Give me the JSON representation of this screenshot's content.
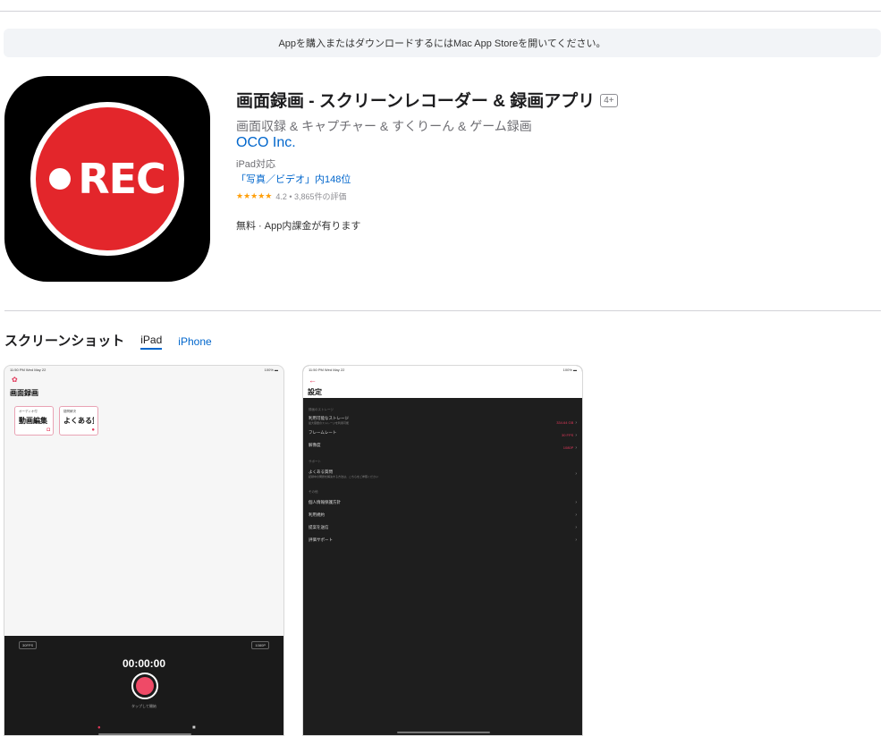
{
  "banner": "Appを購入またはダウンロードするにはMac App Storeを開いてください。",
  "app": {
    "icon_text": "REC",
    "title": "画面録画 - スクリーンレコーダー & 録画アプリ",
    "age": "4+",
    "subtitle": "画面収録 & キャプチャー & すくりーん & ゲーム録画",
    "developer": "OCO Inc.",
    "device": "iPad対応",
    "rank": "「写真／ビデオ」内148位",
    "stars": "★★★★★",
    "rating": "4.2 • 3,865件の評価",
    "price": "無料 · App内課金が有ります"
  },
  "screenshots": {
    "title": "スクリーンショット",
    "tabs": [
      {
        "label": "iPad",
        "active": true
      },
      {
        "label": "iPhone",
        "active": false
      }
    ],
    "shot1": {
      "status_left": "11:50 PM  Wed May 22",
      "status_right": "100% ▬",
      "screen_title": "画面録画",
      "tiles": [
        {
          "tag": "オーディオ付",
          "name": "動画編集"
        },
        {
          "tag": "疑問解決",
          "name": "よくある質問"
        }
      ],
      "chip_left": "30FPS",
      "chip_right": "1080P",
      "timer": "00:00:00",
      "rec_caption": "タップして開始"
    },
    "shot2": {
      "status_left": "11:50 PM  Wed May 22",
      "status_right": "100% ▬",
      "back": "←",
      "screen_title": "設定",
      "sections": [
        {
          "header": "録画のストレージ",
          "rows": [
            {
              "label": "利用可能なストレージ",
              "sub": "最大容量のストレージを利用可能",
              "value": "334.64 GB"
            },
            {
              "label": "フレームレート",
              "sub": "",
              "value": "30 FPS"
            },
            {
              "label": "解像度",
              "sub": "",
              "value": "1080P"
            }
          ]
        },
        {
          "header": "サポート",
          "rows": [
            {
              "label": "よくある質問",
              "sub": "記録中の問題を解決する方法は、こちらをご参照ください",
              "value": ""
            }
          ]
        },
        {
          "header": "その他",
          "rows": [
            {
              "label": "個人情報保護方針",
              "sub": "",
              "value": ""
            },
            {
              "label": "利用規約",
              "sub": "",
              "value": ""
            },
            {
              "label": "提案を送信",
              "sub": "",
              "value": ""
            },
            {
              "label": "評価サポート",
              "sub": "",
              "value": ""
            }
          ]
        }
      ]
    }
  }
}
